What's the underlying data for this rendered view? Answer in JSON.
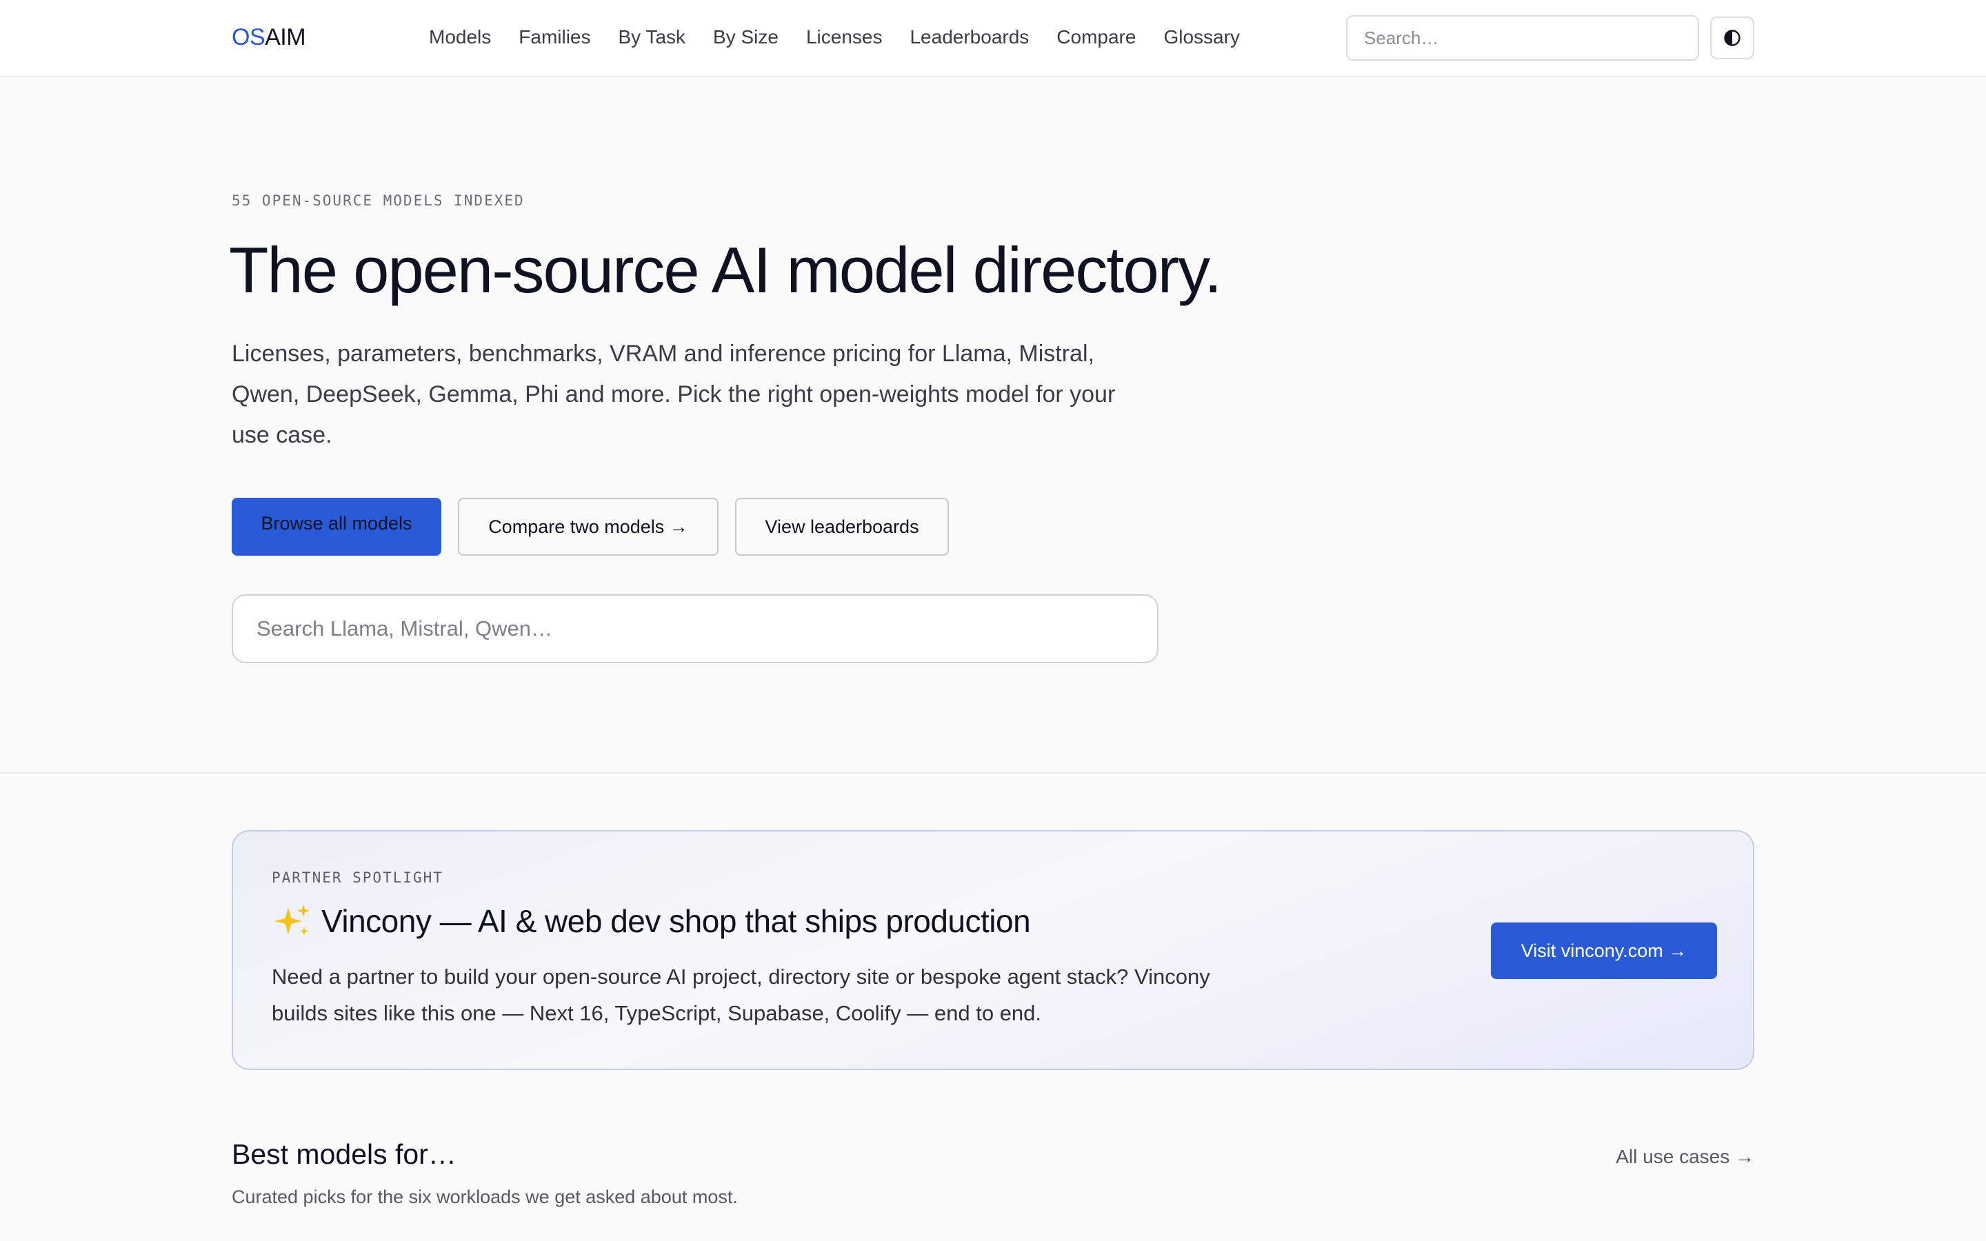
{
  "header": {
    "logo_os": "OS",
    "logo_aim": "AIM",
    "nav": [
      "Models",
      "Families",
      "By Task",
      "By Size",
      "Licenses",
      "Leaderboards",
      "Compare",
      "Glossary"
    ],
    "search_placeholder": "Search…",
    "theme_toggle_icon": "contrast-icon"
  },
  "hero": {
    "eyebrow": "55 OPEN-SOURCE MODELS INDEXED",
    "title": "The open-source AI model directory.",
    "subtitle": "Licenses, parameters, benchmarks, VRAM and inference pricing for Llama, Mistral, Qwen, DeepSeek, Gemma, Phi and more. Pick the right open-weights model for your use case.",
    "primary_button": "Browse all models",
    "compare_button": "Compare two models →",
    "leaderboards_button": "View leaderboards",
    "search_placeholder": "Search Llama, Mistral, Qwen…"
  },
  "partner": {
    "eyebrow": "PARTNER SPOTLIGHT",
    "icon": "sparkles-icon",
    "title": "Vincony — AI & web dev shop that ships production",
    "description": "Need a partner to build your open-source AI project, directory site or bespoke agent stack? Vincony builds sites like this one — Next 16, TypeScript, Supabase, Coolify — end to end.",
    "button": "Visit vincony.com →"
  },
  "best_models": {
    "title": "Best models for…",
    "subtitle": "Curated picks for the six workloads we get asked about most.",
    "link": "All use cases →"
  },
  "colors": {
    "accent": "#2a5bd7",
    "background": "#fafafa",
    "text": "#0f1222"
  }
}
